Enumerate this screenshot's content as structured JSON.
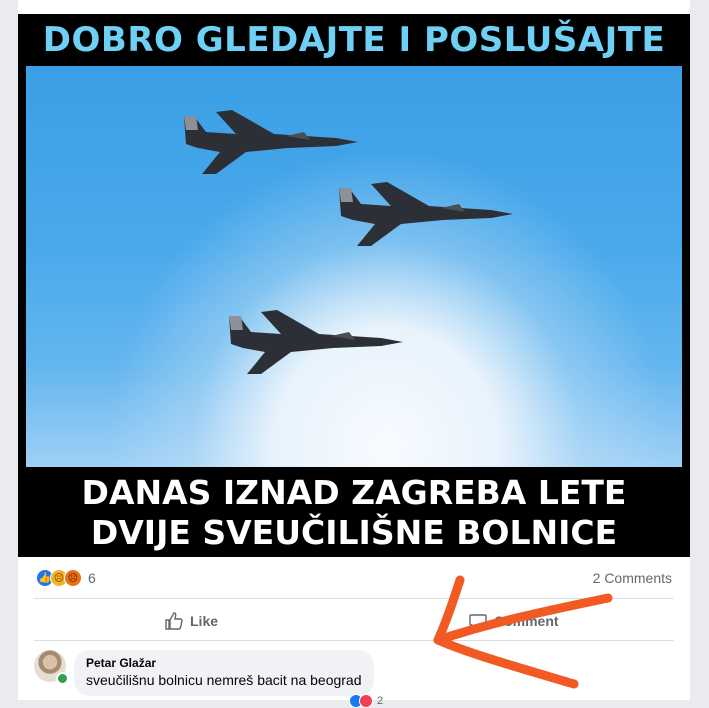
{
  "meme": {
    "top_text": "DOBRO GLEDAJTE I POSLUŠAJTE",
    "bottom_line1": "DANAS IZNAD ZAGREBA LETE",
    "bottom_line2": "DVIJE SVEUČILIŠNE BOLNICE"
  },
  "post": {
    "reaction_count": "6",
    "comments_link": "2 Comments",
    "like_label": "Like",
    "comment_label": "Comment"
  },
  "comment": {
    "author": "Petar Glažar",
    "text": "sveučilišnu bolnicu nemreš bacit na beograd",
    "reaction_count": "2"
  },
  "colors": {
    "meme_top_text": "#6fd0f5",
    "annotation_arrow": "#f15a22",
    "like_blue": "#1877f2"
  }
}
